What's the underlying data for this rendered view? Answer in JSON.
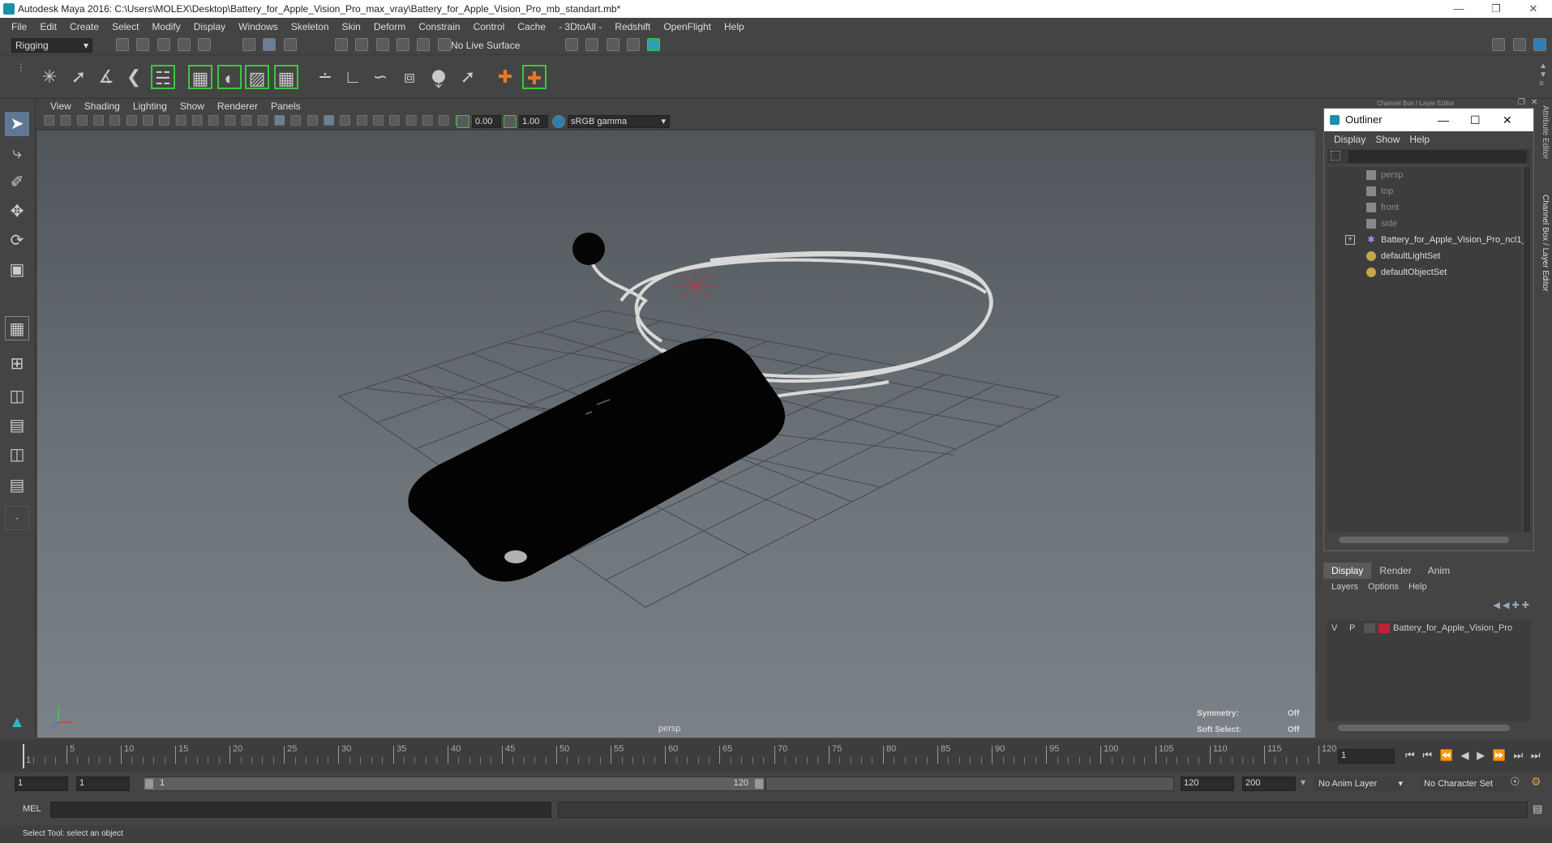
{
  "window": {
    "title": "Autodesk Maya 2016: C:\\Users\\MOLEX\\Desktop\\Battery_for_Apple_Vision_Pro_max_vray\\Battery_for_Apple_Vision_Pro_mb_standart.mb*"
  },
  "menubar": [
    "File",
    "Edit",
    "Create",
    "Select",
    "Modify",
    "Display",
    "Windows",
    "Skeleton",
    "Skin",
    "Deform",
    "Constrain",
    "Control",
    "Cache",
    "- 3DtoAll -",
    "Redshift",
    "OpenFlight",
    "Help"
  ],
  "statusline": {
    "menuset": "Rigging",
    "live_surface": "No Live Surface"
  },
  "viewport": {
    "menu": [
      "View",
      "Shading",
      "Lighting",
      "Show",
      "Renderer",
      "Panels"
    ],
    "near_value": "0.00",
    "far_value": "1.00",
    "color_space": "sRGB gamma",
    "camera_label": "persp",
    "symmetry_label": "Symmetry:",
    "symmetry_value": "Off",
    "soft_select_label": "Soft Select:",
    "soft_select_value": "Off"
  },
  "outliner": {
    "title": "Outliner",
    "menu": [
      "Display",
      "Show",
      "Help"
    ],
    "items": [
      {
        "label": "persp",
        "icon": "camera-icon",
        "dim": true
      },
      {
        "label": "top",
        "icon": "camera-icon",
        "dim": true
      },
      {
        "label": "front",
        "icon": "camera-icon",
        "dim": true
      },
      {
        "label": "side",
        "icon": "camera-icon",
        "dim": true
      },
      {
        "label": "Battery_for_Apple_Vision_Pro_ncl1_",
        "icon": "group-icon",
        "dim": false
      },
      {
        "label": "defaultLightSet",
        "icon": "set-icon",
        "dim": false
      },
      {
        "label": "defaultObjectSet",
        "icon": "set-icon",
        "dim": false
      }
    ],
    "header_label": "Channel Box / Layer Editor"
  },
  "side_tabs": [
    "Attribute Editor",
    "Channel Box / Layer Editor"
  ],
  "layer_editor": {
    "tabs": [
      "Display",
      "Render",
      "Anim"
    ],
    "menu": [
      "Layers",
      "Options",
      "Help"
    ],
    "layer": {
      "v": "V",
      "p": "P",
      "name": "Battery_for_Apple_Vision_Pro",
      "color": "#c0203a"
    }
  },
  "timeslider": {
    "ticks": [
      "1",
      "5",
      "10",
      "15",
      "20",
      "25",
      "30",
      "35",
      "40",
      "45",
      "50",
      "55",
      "60",
      "65",
      "70",
      "75",
      "80",
      "85",
      "90",
      "95",
      "100",
      "105",
      "110",
      "115",
      "120"
    ],
    "current_frame": "1"
  },
  "rangeslider": {
    "start": "1",
    "anim_start": "1",
    "range_start": "1",
    "range_end": "120",
    "playback_end": "120",
    "anim_end": "200",
    "anim_layer": "No Anim Layer",
    "char_set": "No Character Set"
  },
  "cmdline": {
    "label": "MEL"
  },
  "helpline": {
    "text": "Select Tool: select an object"
  },
  "colors": {
    "bg": "#444444",
    "accent_green": "#3ec63e",
    "layer_red": "#c0203a"
  }
}
